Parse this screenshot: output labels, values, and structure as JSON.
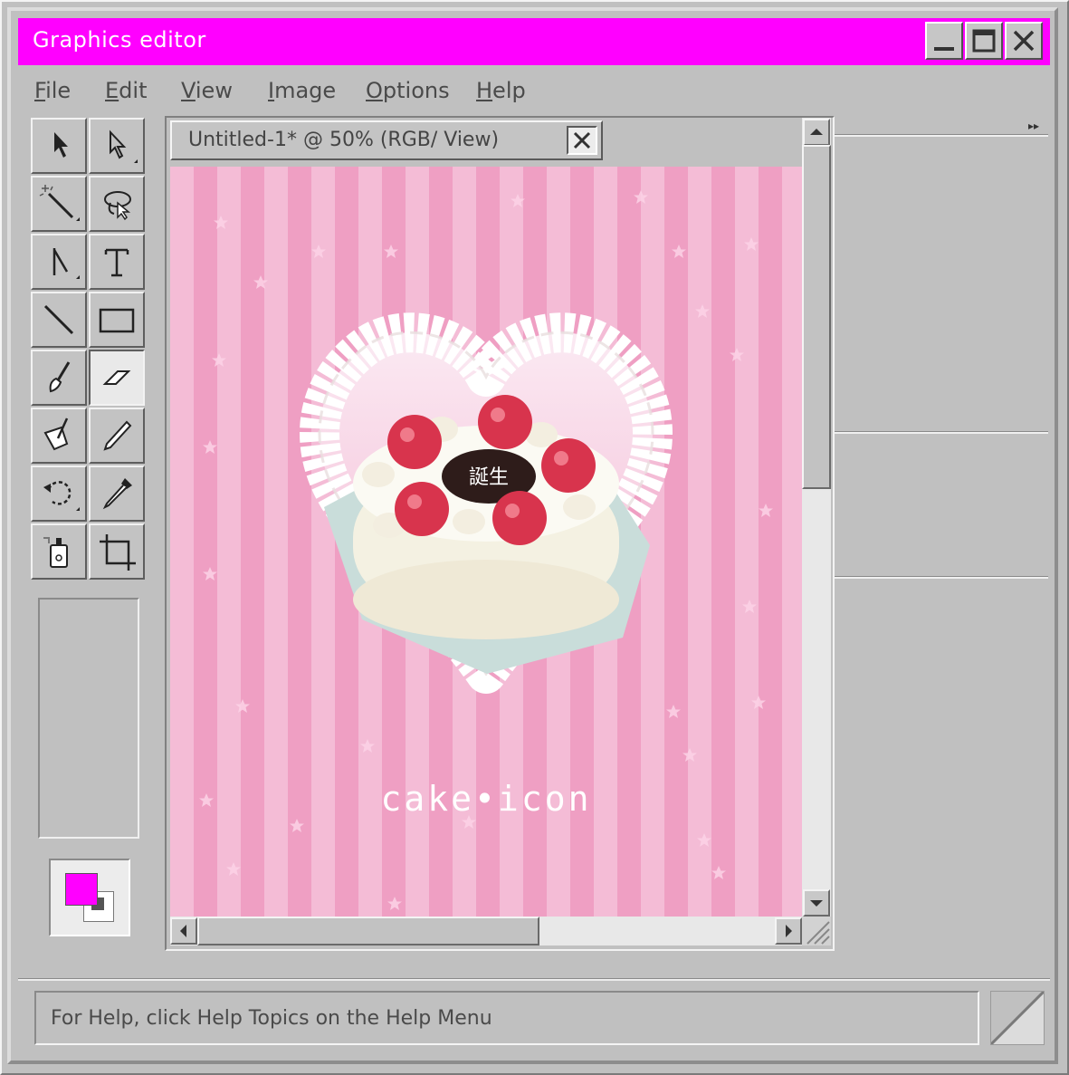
{
  "window": {
    "title": "Graphics editor"
  },
  "title_buttons": {
    "minimize": "minimize",
    "maximize": "maximize",
    "close": "close"
  },
  "menu": [
    {
      "label": "File",
      "accel": "F"
    },
    {
      "label": "Edit",
      "accel": "E"
    },
    {
      "label": "View",
      "accel": "V"
    },
    {
      "label": "Image",
      "accel": "I"
    },
    {
      "label": "Options",
      "accel": "O"
    },
    {
      "label": "Help",
      "accel": "H"
    }
  ],
  "tools": [
    {
      "name": "selection-arrow-icon"
    },
    {
      "name": "direct-selection-icon"
    },
    {
      "name": "magic-wand-icon"
    },
    {
      "name": "lasso-icon"
    },
    {
      "name": "pen-icon"
    },
    {
      "name": "text-tool-icon"
    },
    {
      "name": "line-tool-icon"
    },
    {
      "name": "rectangle-tool-icon"
    },
    {
      "name": "brush-icon"
    },
    {
      "name": "eraser-icon",
      "active": true
    },
    {
      "name": "fill-bucket-icon"
    },
    {
      "name": "pencil-icon"
    },
    {
      "name": "rotate-icon"
    },
    {
      "name": "eyedropper-icon"
    },
    {
      "name": "spray-can-icon"
    },
    {
      "name": "crop-icon"
    }
  ],
  "colors": {
    "foreground": "#ff00ff",
    "background": "#ffffff",
    "accent": "#ff00ff"
  },
  "document": {
    "tab_title": "Untitled-1* @ 50% (RGB/ View)",
    "canvas_caption": "cake•icon",
    "cake_topper_text": "誕生"
  },
  "status": {
    "text": "For Help, click Help Topics on the Help Menu"
  }
}
